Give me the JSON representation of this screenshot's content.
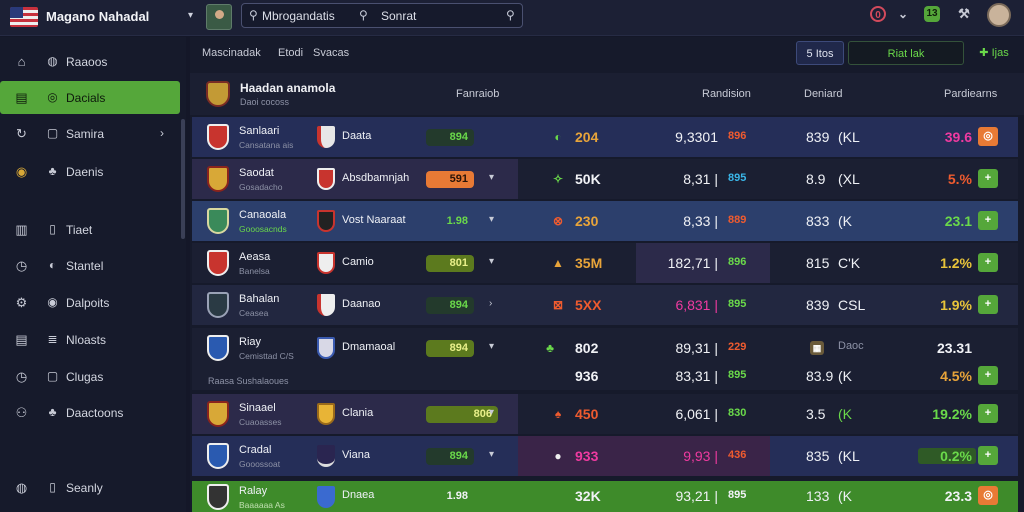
{
  "topbar": {
    "brand": "Magano Nahadal",
    "search_left": "Mbrogandatis",
    "search_right": "Sonrat"
  },
  "colors": {
    "accent": "#55a73a",
    "background": "#141728",
    "positive": "#6ad94a",
    "negative": "#ef5b2f",
    "warning": "#e8a43a",
    "pink": "#ef3aa0"
  },
  "sidebar": {
    "items": [
      {
        "label": "Raaoos",
        "icon": "home-icon"
      },
      {
        "label": "Dacials",
        "icon": "chart-icon"
      },
      {
        "label": "Samira",
        "icon": "refresh-icon"
      },
      {
        "label": "Daenis",
        "icon": "trophy-icon"
      },
      {
        "label": "Tiaet",
        "icon": "book-icon"
      },
      {
        "label": "Stantel",
        "icon": "clock-icon"
      },
      {
        "label": "Dalpoits",
        "icon": "cog-icon"
      },
      {
        "label": "Nloasts",
        "icon": "list-icon"
      },
      {
        "label": "Clugas",
        "icon": "clock-icon"
      },
      {
        "label": "Daactoons",
        "icon": "users-icon"
      },
      {
        "label": "Seanly",
        "icon": "user-icon"
      }
    ]
  },
  "filters": {
    "tab1": "Mascinadak",
    "tab2": "Etodi",
    "tab3": "Svacas",
    "btn1": "5 Itos",
    "btn2": "Riat lak",
    "btn3": "Ijas"
  },
  "header": {
    "title": "Haadan anamola",
    "subtitle": "Daoi cocoss",
    "col1": "Fanraiob",
    "col2": "Randision",
    "col3": "Deniard",
    "col4": "Pardiearns"
  },
  "rows": [
    {
      "team": "Sanlaari",
      "sub": "Cansatana ais",
      "opp": "Daata",
      "pill": "894",
      "caret": "",
      "m_icon": "◐",
      "market": "204",
      "odds": "9,3301",
      "pct": "896",
      "v1": "839",
      "v2": "(KL",
      "result": "39.6",
      "action": "◎"
    },
    {
      "team": "Saodat",
      "sub": "Gosadacho",
      "opp": "Absdbamnjah",
      "pill": "591",
      "caret": "▾",
      "m_icon": "✧",
      "market": "50K",
      "odds": "8,31 |",
      "pct": "895",
      "v1": "8.9",
      "v2": "(XL",
      "result": "5.%",
      "action": "+"
    },
    {
      "team": "Canaoala",
      "sub": "Gooosacnds",
      "opp": "Vost Naaraat",
      "pill": "1.98",
      "caret": "▾",
      "m_icon": "⊗",
      "market": "230",
      "odds": "8,33 |",
      "pct": "889",
      "v1": "833",
      "v2": "(K",
      "result": "23.1",
      "action": "+"
    },
    {
      "team": "Aeasa",
      "sub": "Banelsa",
      "opp": "Camio",
      "pill": "801",
      "caret": "▾",
      "m_icon": "▲",
      "market": "35M",
      "odds": "182,71 |",
      "pct": "896",
      "v1": "815",
      "v2": "C'K",
      "result": "1.2%",
      "action": "+"
    },
    {
      "team": "Bahalan",
      "sub": "Ceasea",
      "opp": "Daanao",
      "pill": "894",
      "caret": "›",
      "m_icon": "⊠",
      "market": "5XX",
      "odds": "6,831 |",
      "pct": "895",
      "v1": "839",
      "v2": "CSL",
      "result": "1.9%",
      "action": "+"
    },
    {
      "team": "Riay",
      "sub": "Cemisttad C/S",
      "opp": "Dmamaoal",
      "pill": "894",
      "caret": "▾",
      "m_icon": "♣",
      "market": "802",
      "odds": "89,31 |",
      "pct": "229",
      "v1": "",
      "v2": "Daoc",
      "result": "23.31",
      "action": ""
    },
    {
      "team": "",
      "sub": "",
      "opp": "",
      "pill": "",
      "caret": "",
      "m_icon": "",
      "market": "936",
      "odds": "83,31 |",
      "pct": "895",
      "v1": "83.9",
      "v2": "(K",
      "result": "4.5%",
      "action": "+"
    },
    {
      "team": "Sinaael",
      "sub": "Cuaoasses",
      "opp": "Clania",
      "pill": "806",
      "caret": "▾",
      "m_icon": "♠",
      "market": "450",
      "odds": "6,061 |",
      "pct": "830",
      "v1": "3.5",
      "v2": "(K",
      "result": "19.2%",
      "action": "+"
    },
    {
      "team": "Cradal",
      "sub": "Gooossoat",
      "opp": "Viana",
      "pill": "894",
      "caret": "▾",
      "m_icon": "●",
      "market": "933",
      "odds": "9,93 |",
      "pct": "436",
      "v1": "835",
      "v2": "(KL",
      "result": "0.2%",
      "action": "+"
    },
    {
      "team": "Ralay",
      "sub": "Baaaaaa As",
      "opp": "Dnaea",
      "pill": "1.98",
      "caret": "",
      "m_icon": "",
      "market": "32K",
      "odds": "93,21 |",
      "pct": "895",
      "v1": "133",
      "v2": "(K",
      "result": "23.3",
      "action": "◎"
    }
  ],
  "group_label": "Raasa Sushalaoues"
}
